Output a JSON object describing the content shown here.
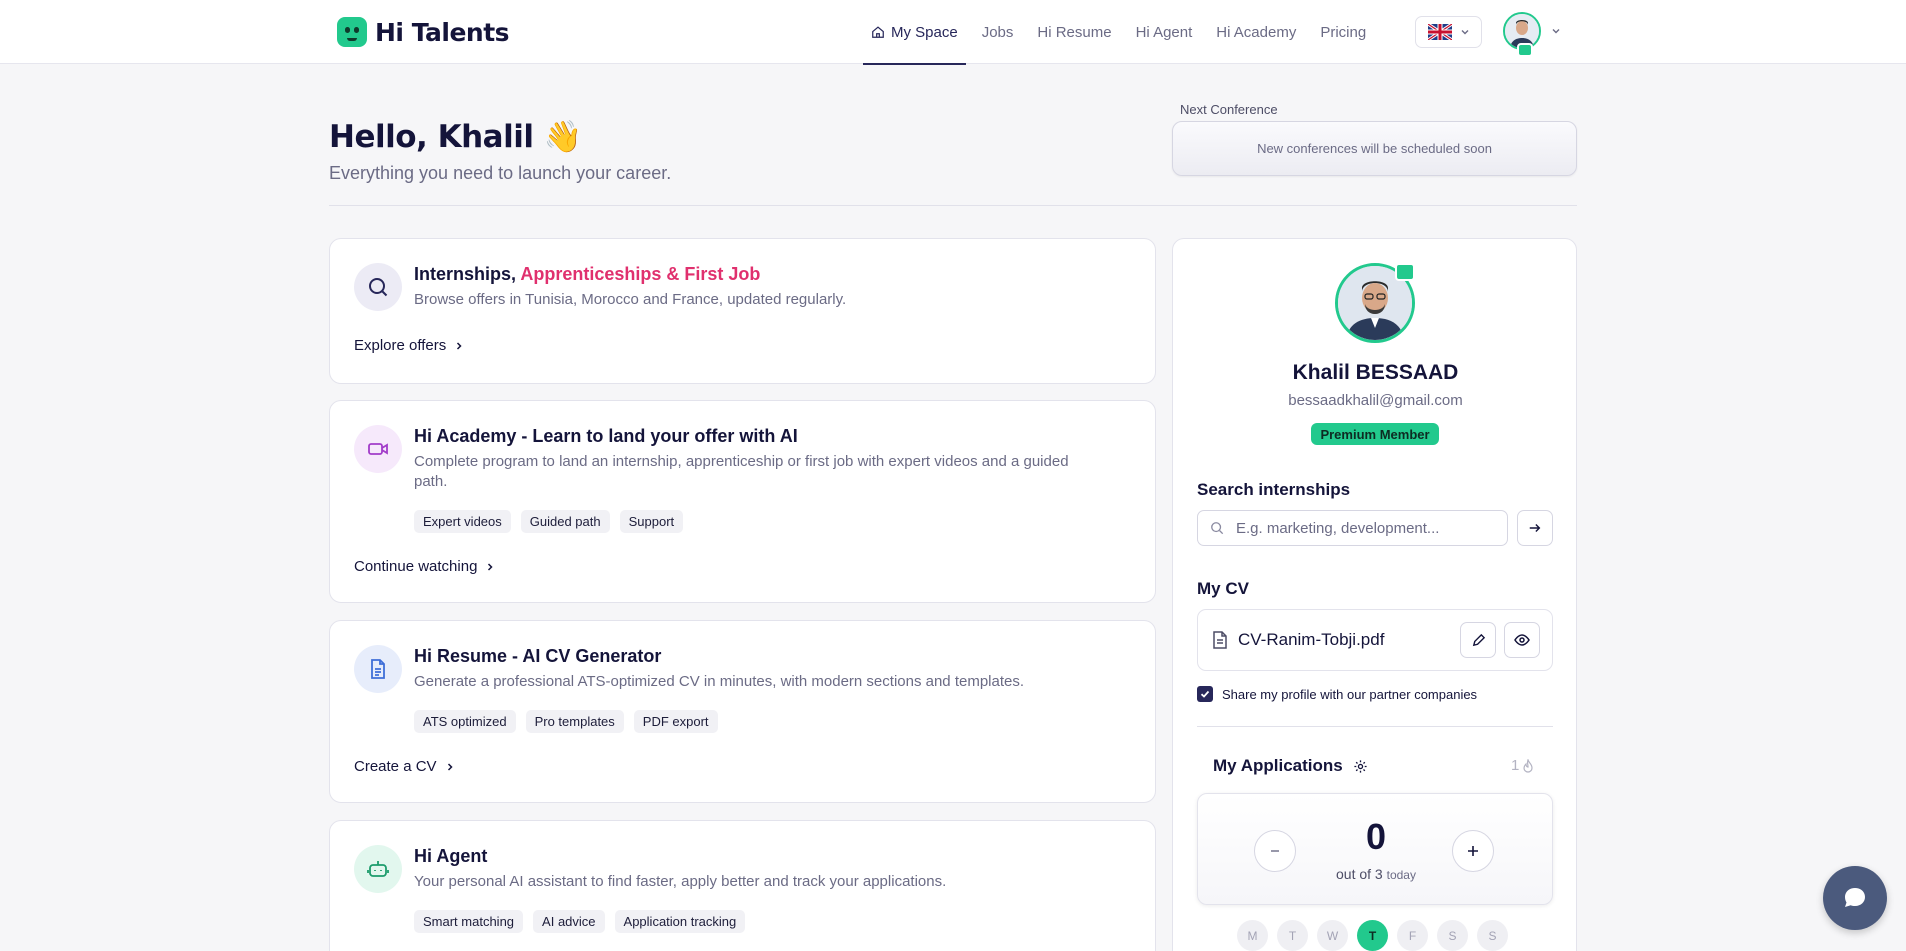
{
  "brand": {
    "name": "Hi Talents"
  },
  "nav": {
    "items": [
      {
        "label": "My Space",
        "active": true
      },
      {
        "label": "Jobs"
      },
      {
        "label": "Hi Resume"
      },
      {
        "label": "Hi Agent"
      },
      {
        "label": "Hi Academy"
      },
      {
        "label": "Pricing"
      }
    ]
  },
  "header": {
    "greeting": "Hello, Khalil 👋",
    "subtitle": "Everything you need to launch your career."
  },
  "conference": {
    "label": "Next Conference",
    "message": "New conferences will be scheduled soon"
  },
  "cards": [
    {
      "title_plain": "Internships, ",
      "title_accent": "Apprenticeships & First Job",
      "description": "Browse offers in Tunisia, Morocco and France, updated regularly.",
      "link": "Explore offers",
      "icon": "search-icon"
    },
    {
      "title": "Hi Academy - Learn to land your offer with AI",
      "description": "Complete program to land an internship, apprenticeship or first job with expert videos and a guided path.",
      "tags": [
        "Expert videos",
        "Guided path",
        "Support"
      ],
      "link": "Continue watching",
      "icon": "video-icon"
    },
    {
      "title": "Hi Resume - AI CV Generator",
      "description": "Generate a professional ATS-optimized CV in minutes, with modern sections and templates.",
      "tags": [
        "ATS optimized",
        "Pro templates",
        "PDF export"
      ],
      "link": "Create a CV",
      "icon": "document-icon"
    },
    {
      "title": "Hi Agent",
      "description": "Your personal AI assistant to find faster, apply better and track your applications.",
      "tags": [
        "Smart matching",
        "AI advice",
        "Application tracking"
      ],
      "icon": "robot-icon"
    }
  ],
  "profile": {
    "name": "Khalil BESSAAD",
    "email": "bessaadkhalil@gmail.com",
    "badge": "Premium Member"
  },
  "search": {
    "label": "Search internships",
    "placeholder": "E.g. marketing, development..."
  },
  "cv": {
    "label": "My CV",
    "filename": "CV-Ranim-Tobji.pdf",
    "share_label": "Share my profile with our partner companies",
    "share_checked": true
  },
  "applications": {
    "label": "My Applications",
    "streak": "1",
    "count": "0",
    "out_of_prefix": "out of 3",
    "out_of_suffix": "today",
    "days": [
      "M",
      "T",
      "W",
      "T",
      "F",
      "S",
      "S"
    ],
    "today_index": 3
  },
  "colors": {
    "brand_green": "#22c98d",
    "accent_pink": "#e0306e",
    "navy": "#27275a"
  }
}
